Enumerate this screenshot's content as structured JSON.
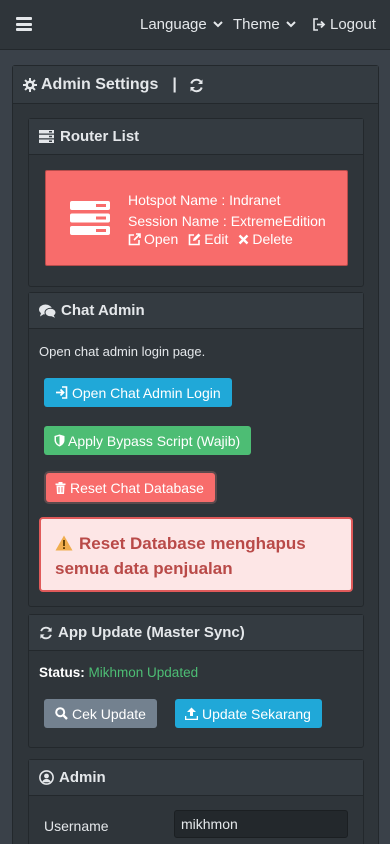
{
  "topbar": {
    "language_label": "Language",
    "theme_label": "Theme",
    "logout_label": "Logout"
  },
  "admin_settings": {
    "title": "Admin Settings",
    "separator": "|"
  },
  "router_list": {
    "title": "Router List",
    "router": {
      "hotspot_line": "Hotspot Name : Indranet",
      "session_line": "Session Name : ExtremeEdition",
      "open_label": "Open",
      "edit_label": "Edit",
      "delete_label": "Delete"
    }
  },
  "chat_admin": {
    "title": "Chat Admin",
    "description": "Open chat admin login page.",
    "open_login_label": "Open Chat Admin Login",
    "bypass_label": "Apply Bypass Script (Wajib)",
    "reset_label": "Reset Chat Database",
    "warning_text": "Reset Database menghapus semua data penjualan"
  },
  "app_update": {
    "title": "App Update (Master Sync)",
    "status_label": "Status:",
    "status_value": "Mikhmon Updated",
    "check_label": "Cek Update",
    "update_label": "Update Sekarang"
  },
  "admin": {
    "title": "Admin",
    "username_label": "Username",
    "username_value": "mikhmon"
  },
  "colors": {
    "danger": "#f86c6b",
    "info": "#20a8d8",
    "success": "#4dbd74",
    "secondary": "#73818f",
    "background": "#3a4149"
  }
}
